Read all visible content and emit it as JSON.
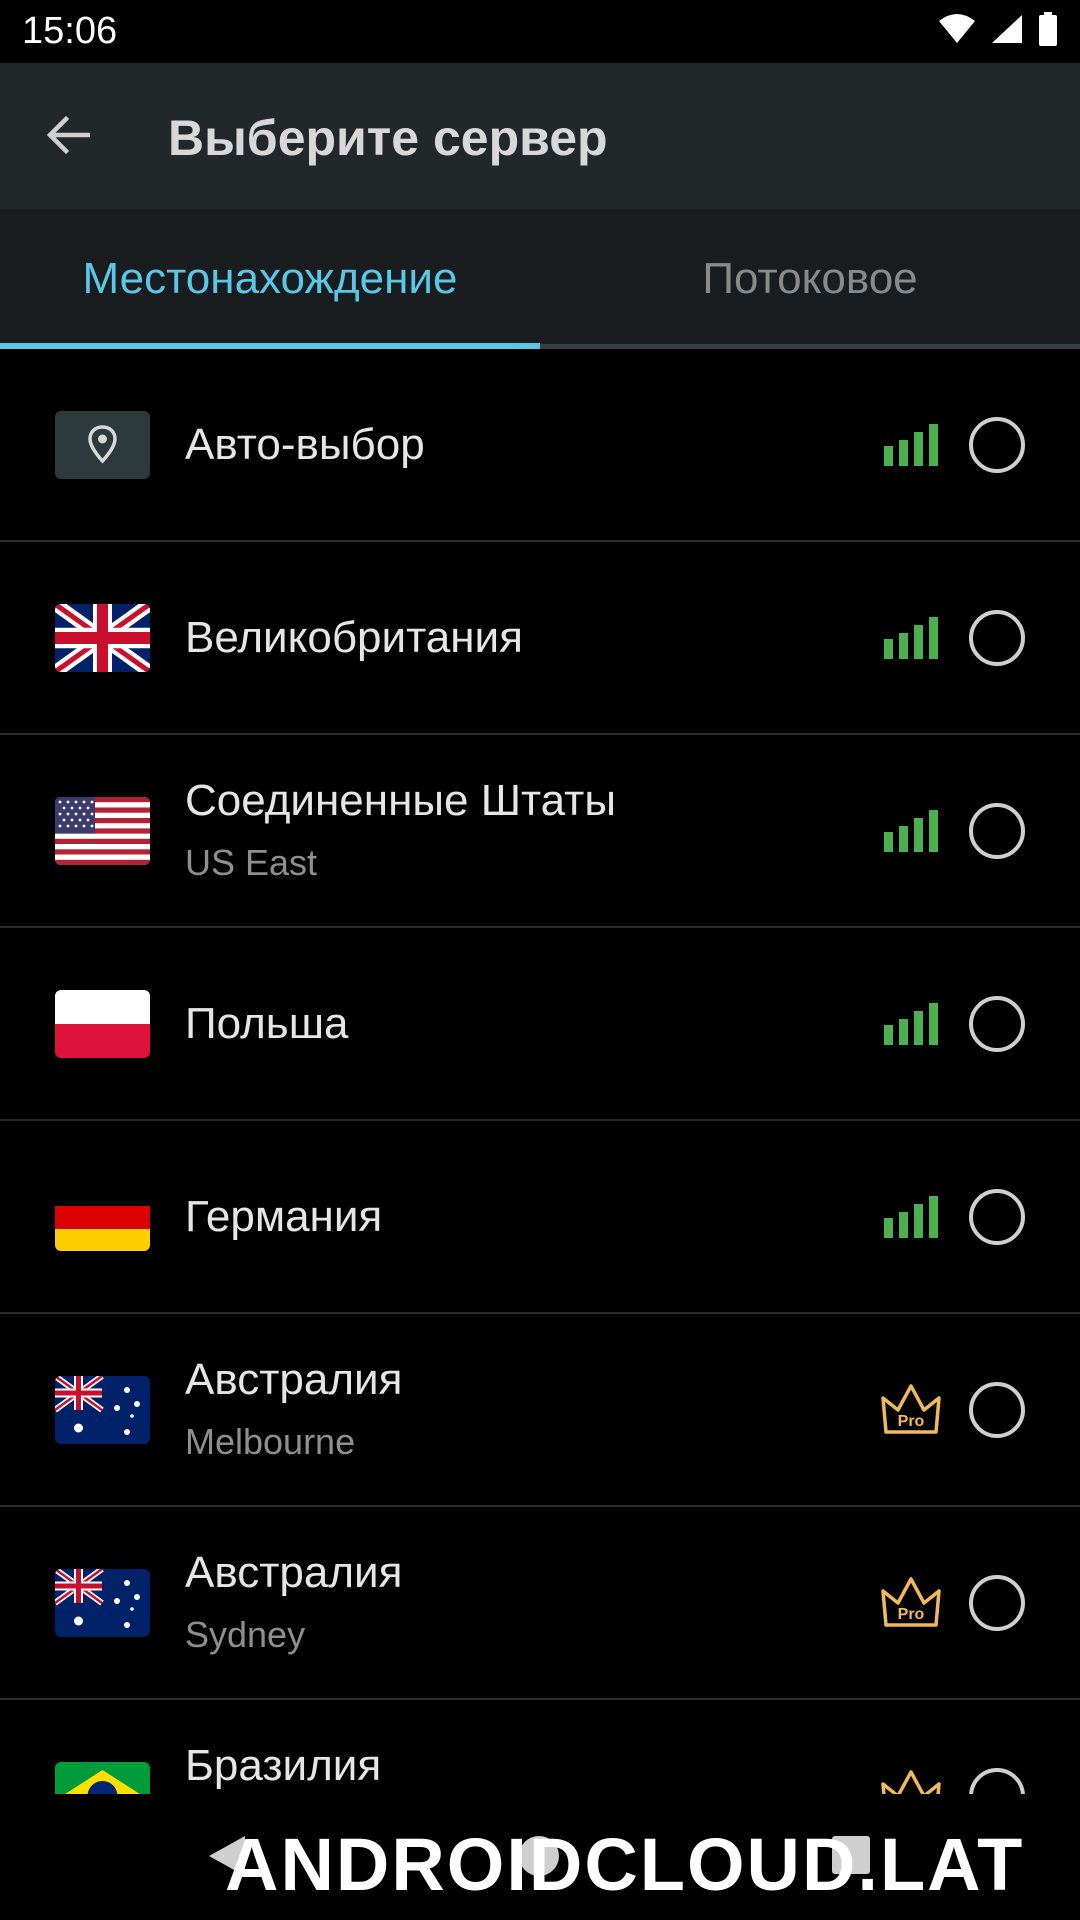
{
  "status_bar": {
    "time": "15:06"
  },
  "toolbar": {
    "title": "Выберите сервер"
  },
  "tabs": [
    {
      "label": "Местонахождение",
      "active": true
    },
    {
      "label": "Потоковое",
      "active": false
    }
  ],
  "colors": {
    "accent": "#5bc7e6",
    "signal": "#4caf50",
    "pro": "#f0b95a",
    "background": "#000000"
  },
  "servers": [
    {
      "name": "Авто-выбор",
      "subtitle": "",
      "icon": "location-pin-icon",
      "badge": "signal"
    },
    {
      "name": "Великобритания",
      "subtitle": "",
      "icon": "uk-flag-icon",
      "badge": "signal"
    },
    {
      "name": "Соединенные Штаты",
      "subtitle": "US East",
      "icon": "us-flag-icon",
      "badge": "signal"
    },
    {
      "name": "Польша",
      "subtitle": "",
      "icon": "poland-flag-icon",
      "badge": "signal"
    },
    {
      "name": "Германия",
      "subtitle": "",
      "icon": "germany-flag-icon",
      "badge": "signal"
    },
    {
      "name": "Австралия",
      "subtitle": "Melbourne",
      "icon": "australia-flag-icon",
      "badge": "pro"
    },
    {
      "name": "Австралия",
      "subtitle": "Sydney",
      "icon": "australia-flag-icon",
      "badge": "pro"
    },
    {
      "name": "Бразилия",
      "subtitle": "",
      "icon": "brazil-flag-icon",
      "badge": "pro"
    }
  ],
  "pro_label": "Pro",
  "watermark": "ANDROIDCLOUD.LAT"
}
